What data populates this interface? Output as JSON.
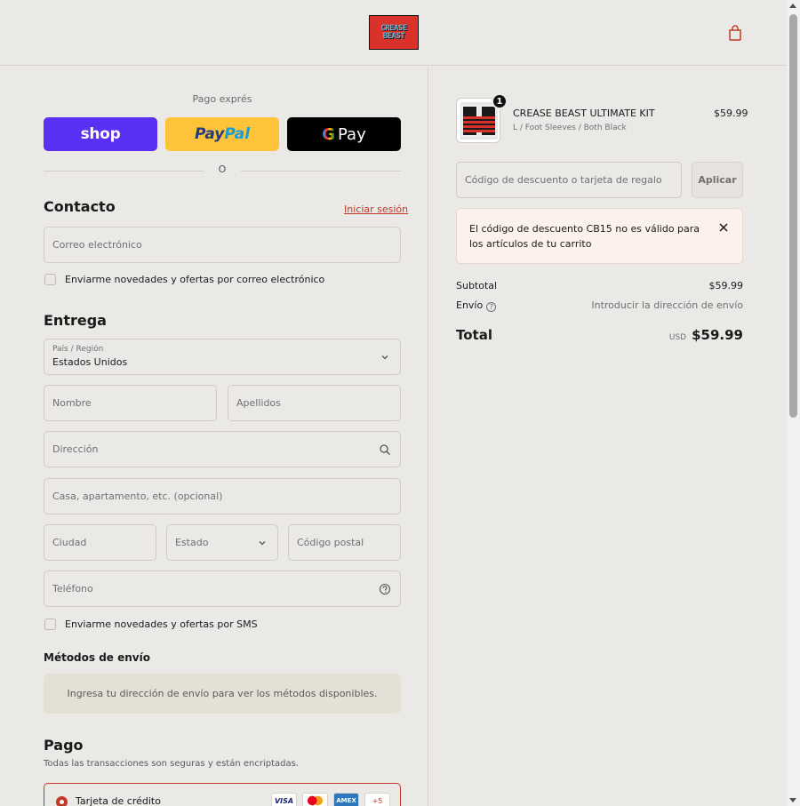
{
  "header": {
    "logo_line1": "CREASE",
    "logo_line2": "BEAST"
  },
  "express": {
    "title": "Pago exprés",
    "shop_label": "shop",
    "paypal_label_1": "Pay",
    "paypal_label_2": "Pal",
    "gpay_g": "G",
    "gpay_label": "Pay",
    "divider_text": "O"
  },
  "contact": {
    "heading": "Contacto",
    "login_link": "Iniciar sesión",
    "email_placeholder": "Correo electrónico",
    "newsletter_label": "Enviarme novedades y ofertas por correo electrónico"
  },
  "delivery": {
    "heading": "Entrega",
    "country_label": "País / Región",
    "country_value": "Estados Unidos",
    "first_name_placeholder": "Nombre",
    "last_name_placeholder": "Apellidos",
    "address_placeholder": "Dirección",
    "apartment_placeholder": "Casa, apartamento, etc. (opcional)",
    "city_placeholder": "Ciudad",
    "state_placeholder": "Estado",
    "zip_placeholder": "Código postal",
    "phone_placeholder": "Teléfono",
    "sms_label": "Enviarme novedades y ofertas por SMS"
  },
  "shipping": {
    "heading": "Métodos de envío",
    "info": "Ingresa tu dirección de envío para ver los métodos disponibles."
  },
  "payment": {
    "heading": "Pago",
    "subtitle": "Todas las transacciones son seguras y están encriptadas.",
    "card_label": "Tarjeta de crédito",
    "cards": [
      "VISA",
      "MC",
      "AMEX",
      "+5"
    ]
  },
  "order": {
    "quantity": "1",
    "product_title": "CREASE BEAST ULTIMATE KIT",
    "product_variant": "L / Foot Sleeves / Both Black",
    "product_price": "$59.99",
    "discount_placeholder": "Código de descuento o tarjeta de regalo",
    "apply_label": "Aplicar",
    "alert_text": "El código de descuento CB15 no es válido para los artículos de tu carrito",
    "subtotal_label": "Subtotal",
    "subtotal_value": "$59.99",
    "shipping_label": "Envío",
    "shipping_value": "Introducir la dirección de envío",
    "total_label": "Total",
    "total_currency": "USD",
    "total_value": "$59.99"
  },
  "colors": {
    "accent": "#c0392b",
    "shop": "#5a31f4",
    "paypal": "#ffc439",
    "gpay": "#000000",
    "background": "#ebe9e5"
  }
}
